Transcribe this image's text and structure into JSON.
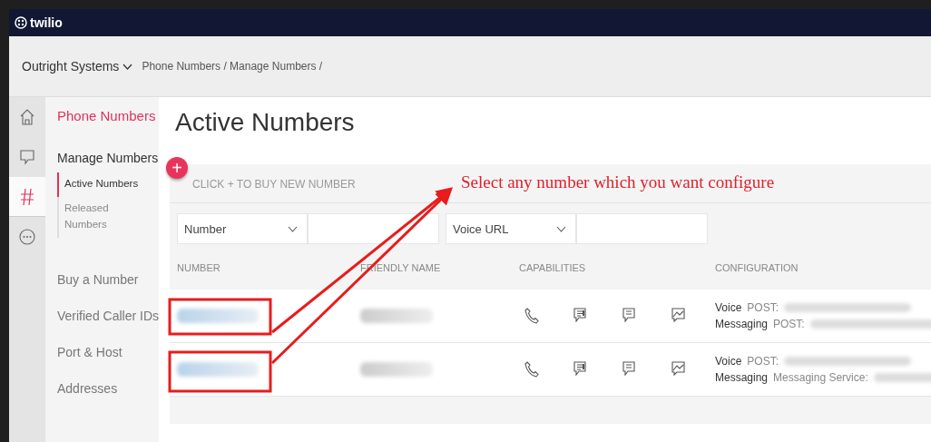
{
  "topbar": {
    "logo": "twilio"
  },
  "breadcrumb": {
    "account": "Outright Systems",
    "path": "Phone Numbers / Manage Numbers /"
  },
  "rail": [
    {
      "kind": "home",
      "selected": false
    },
    {
      "kind": "chat",
      "selected": false
    },
    {
      "kind": "hash",
      "selected": true
    },
    {
      "kind": "more",
      "selected": false
    }
  ],
  "sidebar": {
    "title": "Phone Numbers",
    "items": [
      {
        "label": "Manage Numbers",
        "children": [
          {
            "label": "Active Numbers",
            "selected": true
          },
          {
            "label": "Released Numbers",
            "selected": false
          }
        ]
      },
      {
        "label": "Buy a Number"
      },
      {
        "label": "Verified Caller IDs"
      },
      {
        "label": "Port & Host"
      },
      {
        "label": "Addresses"
      }
    ]
  },
  "main": {
    "title": "Active Numbers",
    "add_button": "+",
    "buy_hint": "CLICK + TO BUY NEW NUMBER",
    "filters": [
      {
        "kind": "select",
        "value": "Number"
      },
      {
        "kind": "input"
      },
      {
        "kind": "select",
        "value": "Voice URL"
      },
      {
        "kind": "input"
      }
    ],
    "table": {
      "columns": [
        "NUMBER",
        "FRIENDLY NAME",
        "CAPABILITIES",
        "CONFIGURATION"
      ],
      "rows": [
        {
          "config": [
            {
              "label": "Voice",
              "detail": "POST:"
            },
            {
              "label": "Messaging",
              "detail": "POST:"
            }
          ]
        },
        {
          "config": [
            {
              "label": "Voice",
              "detail": "POST:"
            },
            {
              "label": "Messaging",
              "detail": "Messaging Service:"
            }
          ]
        }
      ]
    }
  },
  "annotation": {
    "callout": "Select any number which you want configure"
  }
}
